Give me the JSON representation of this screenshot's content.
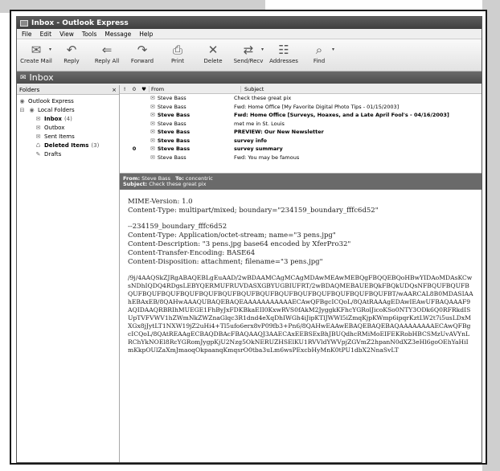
{
  "window": {
    "title": "Inbox - Outlook Express"
  },
  "menu": [
    "File",
    "Edit",
    "View",
    "Tools",
    "Message",
    "Help"
  ],
  "toolbar": [
    {
      "label": "Create Mail",
      "icon": "create-mail-icon",
      "glyph": "✉",
      "dropdown": true
    },
    {
      "label": "Reply",
      "icon": "reply-icon",
      "glyph": "↶"
    },
    {
      "label": "Reply All",
      "icon": "reply-all-icon",
      "glyph": "⇐"
    },
    {
      "label": "Forward",
      "icon": "forward-icon",
      "glyph": "↷"
    },
    {
      "label": "Print",
      "icon": "print-icon",
      "glyph": "⎙"
    },
    {
      "label": "Delete",
      "icon": "delete-icon",
      "glyph": "✕"
    },
    {
      "label": "Send/Recv",
      "icon": "send-recv-icon",
      "glyph": "⇄",
      "dropdown": true
    },
    {
      "label": "Addresses",
      "icon": "addresses-icon",
      "glyph": "☷"
    },
    {
      "label": "Find",
      "icon": "find-icon",
      "glyph": "⌕",
      "dropdown": true
    }
  ],
  "folder_bar": {
    "title": "Inbox"
  },
  "folders_pane": {
    "title": "Folders",
    "close": "×",
    "items": [
      {
        "label": "Outlook Express",
        "level": 0,
        "bold": false,
        "count": ""
      },
      {
        "label": "Local Folders",
        "level": 1,
        "bold": false,
        "count": "",
        "expander": "⊟"
      },
      {
        "label": "Inbox",
        "level": 2,
        "bold": true,
        "count": "(4)"
      },
      {
        "label": "Outbox",
        "level": 2,
        "bold": false,
        "count": ""
      },
      {
        "label": "Sent Items",
        "level": 2,
        "bold": false,
        "count": ""
      },
      {
        "label": "Deleted Items",
        "level": 2,
        "bold": true,
        "count": "(3)"
      },
      {
        "label": "Drafts",
        "level": 2,
        "bold": false,
        "count": ""
      }
    ]
  },
  "message_list": {
    "columns": {
      "priority": "!",
      "attach": "0",
      "flag": "♥",
      "from": "From",
      "subject": "Subject"
    },
    "rows": [
      {
        "from": "Steve Bass",
        "subject": "Check these great pix",
        "bold": false,
        "attach": ""
      },
      {
        "from": "Steve Bass",
        "subject": "Fwd: Home Office [My Favorite Digital Photo Tips - 01/15/2003]",
        "bold": false,
        "attach": ""
      },
      {
        "from": "Steve Bass",
        "subject": "Fwd: Home Office [Surveys, Hoaxes, and a Late April Fool's - 04/16/2003]",
        "bold": true,
        "attach": ""
      },
      {
        "from": "Steve Bass",
        "subject": "met me in St. Louis",
        "bold": false,
        "attach": ""
      },
      {
        "from": "Steve Bass",
        "subject": "PREVIEW: Our New Newsletter",
        "bold": true,
        "attach": ""
      },
      {
        "from": "Steve Bass",
        "subject": "survey info",
        "bold": true,
        "attach": ""
      },
      {
        "from": "Steve Bass",
        "subject": "survey summary",
        "bold": true,
        "attach": "0"
      },
      {
        "from": "Steve Bass",
        "subject": "Fwd: You may be famous",
        "bold": false,
        "attach": ""
      }
    ]
  },
  "preview": {
    "from_label": "From:",
    "from": "Steve Bass",
    "to_label": "To:",
    "to": "concentric",
    "subject_label": "Subject:",
    "subject": "Check these great pix",
    "body_lines": [
      "MIME-Version: 1.0",
      "Content-Type: multipart/mixed; boundary=\"234159_boundary_fffc6d52\"",
      "",
      "--234159_boundary_fffc6d52",
      "Content-Type: Application/octet-stream; name=\"3 pens.jpg\"",
      "Content-Description: \"3 pens.jpg base64 encoded by XferPro32\"",
      "Content-Transfer-Encoding: BASE64",
      "Content-Disposition: attachment; filename=\"3 pens.jpg\"",
      ""
    ],
    "base64": "/9j/4AAQSkZJRgABAQEBLgEuAAD/2wBDAAMCAgMCAgMDAwMEAwMEBQgFBQQEBQoHBwYIDAoMDAsKCwsNDhIQDQ4RDgsLEBYQERMUFRUVDASXGBYUGBIUFRT/2wBDAQMEBAUEBQkFBQkUDQsNFBQUFBQUFBQUFBQUFBQUFBQUFBQUFBQUFBQUFBQUFBQUFBQUFBQUFBQUFBQUFBQUFBT/wAARCAL8B0MDASIAAhEBAxEB/8QAHwAAAQUBAQEBAQEAAAAAAAAAAAECAwQFBgcICQoL/8QAtRAAAgEDAwIEAwUFBAQAAAF9AQIDAAQRBRIhMUEGE1FhByJxFDKBkaEII0KxwRVS0fAkM2JyggkKFhcYGRolJicoKSo0NTY3ODk6Q0RFRkdISUpTVFVWV1hZWmNkZWZnaGlqc3R1dnd4eXqDhIWGh4iJipKTlJWWl5iZmqKjpKWmp6ipqrKztLW2t7i5usLDxMXGx8jJytLT1NXW19jZ2uHi4+Tl5ufo6erx8vP09fb3+Pn6/8QAHwEAAwEBAQEBAQEBAQAAAAAAAAECAwQFBgcICQoL/8QAtREAAgECBAQDBAcFBAQAAQJ3AAECAxEEBSExBhJBUQdhcRMiMoEIFEKRobHBCSMzUvAVYnLRChYkNOEl8RcYGRomJygpKjU2Nzg5OkNERUZHSElKU1RVVldYWVpjZGVmZ2hpanN0dXZ3eHl6goOEhYaHiImKkpOUlZaXmJmaoqOkpaanqKmqsrO0tba3uLm6wsPExcbHyMnK0tPU1dbX2NnaSvLT"
  }
}
